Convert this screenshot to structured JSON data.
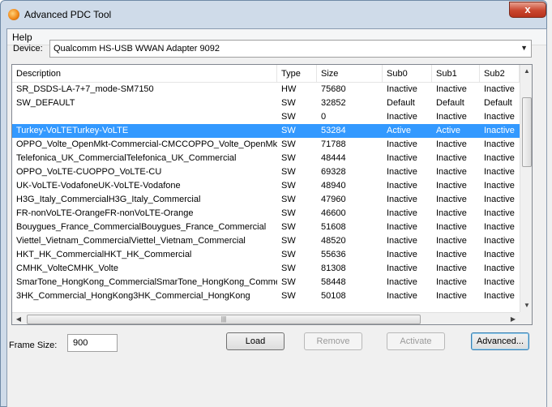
{
  "window": {
    "title": "Advanced PDC Tool",
    "close_symbol": "x"
  },
  "menu": {
    "help": "Help"
  },
  "device": {
    "label": "Device:",
    "value": "Qualcomm HS-USB WWAN Adapter 9092"
  },
  "table": {
    "columns": [
      "Description",
      "Type",
      "Size",
      "Sub0",
      "Sub1",
      "Sub2"
    ],
    "selected_row": 3,
    "rows": [
      [
        "SR_DSDS-LA-7+7_mode-SM7150",
        "HW",
        "75680",
        "Inactive",
        "Inactive",
        "Inactive"
      ],
      [
        "SW_DEFAULT",
        "SW",
        "32852",
        "Default",
        "Default",
        "Default"
      ],
      [
        "",
        "SW",
        "0",
        "Inactive",
        "Inactive",
        "Inactive"
      ],
      [
        "Turkey-VoLTETurkey-VoLTE",
        "SW",
        "53284",
        "Active",
        "Active",
        "Inactive"
      ],
      [
        "OPPO_Volte_OpenMkt-Commercial-CMCCOPPO_Volte_OpenMkt...",
        "SW",
        "71788",
        "Inactive",
        "Inactive",
        "Inactive"
      ],
      [
        "Telefonica_UK_CommercialTelefonica_UK_Commercial",
        "SW",
        "48444",
        "Inactive",
        "Inactive",
        "Inactive"
      ],
      [
        "OPPO_VoLTE-CUOPPO_VoLTE-CU",
        "SW",
        "69328",
        "Inactive",
        "Inactive",
        "Inactive"
      ],
      [
        "UK-VoLTE-VodafoneUK-VoLTE-Vodafone",
        "SW",
        "48940",
        "Inactive",
        "Inactive",
        "Inactive"
      ],
      [
        "H3G_Italy_CommercialH3G_Italy_Commercial",
        "SW",
        "47960",
        "Inactive",
        "Inactive",
        "Inactive"
      ],
      [
        "FR-nonVoLTE-OrangeFR-nonVoLTE-Orange",
        "SW",
        "46600",
        "Inactive",
        "Inactive",
        "Inactive"
      ],
      [
        "Bouygues_France_CommercialBouygues_France_Commercial",
        "SW",
        "51608",
        "Inactive",
        "Inactive",
        "Inactive"
      ],
      [
        "Viettel_Vietnam_CommercialViettel_Vietnam_Commercial",
        "SW",
        "48520",
        "Inactive",
        "Inactive",
        "Inactive"
      ],
      [
        "HKT_HK_CommercialHKT_HK_Commercial",
        "SW",
        "55636",
        "Inactive",
        "Inactive",
        "Inactive"
      ],
      [
        "CMHK_VolteCMHK_Volte",
        "SW",
        "81308",
        "Inactive",
        "Inactive",
        "Inactive"
      ],
      [
        "SmarTone_HongKong_CommercialSmarTone_HongKong_Comme...",
        "SW",
        "58448",
        "Inactive",
        "Inactive",
        "Inactive"
      ],
      [
        "3HK_Commercial_HongKong3HK_Commercial_HongKong",
        "SW",
        "50108",
        "Inactive",
        "Inactive",
        "Inactive"
      ]
    ]
  },
  "frame_size": {
    "label": "Frame Size:",
    "value": "900"
  },
  "buttons": {
    "load": "Load",
    "remove": "Remove",
    "activate": "Activate",
    "advanced": "Advanced..."
  },
  "icons": {
    "app": "pdc-app-icon",
    "close": "close-icon",
    "dropdown": "chevron-down-icon"
  },
  "colors": {
    "selection": "#3399ff",
    "titlebar": "#cfdbe9",
    "close_button": "#c9462e"
  }
}
